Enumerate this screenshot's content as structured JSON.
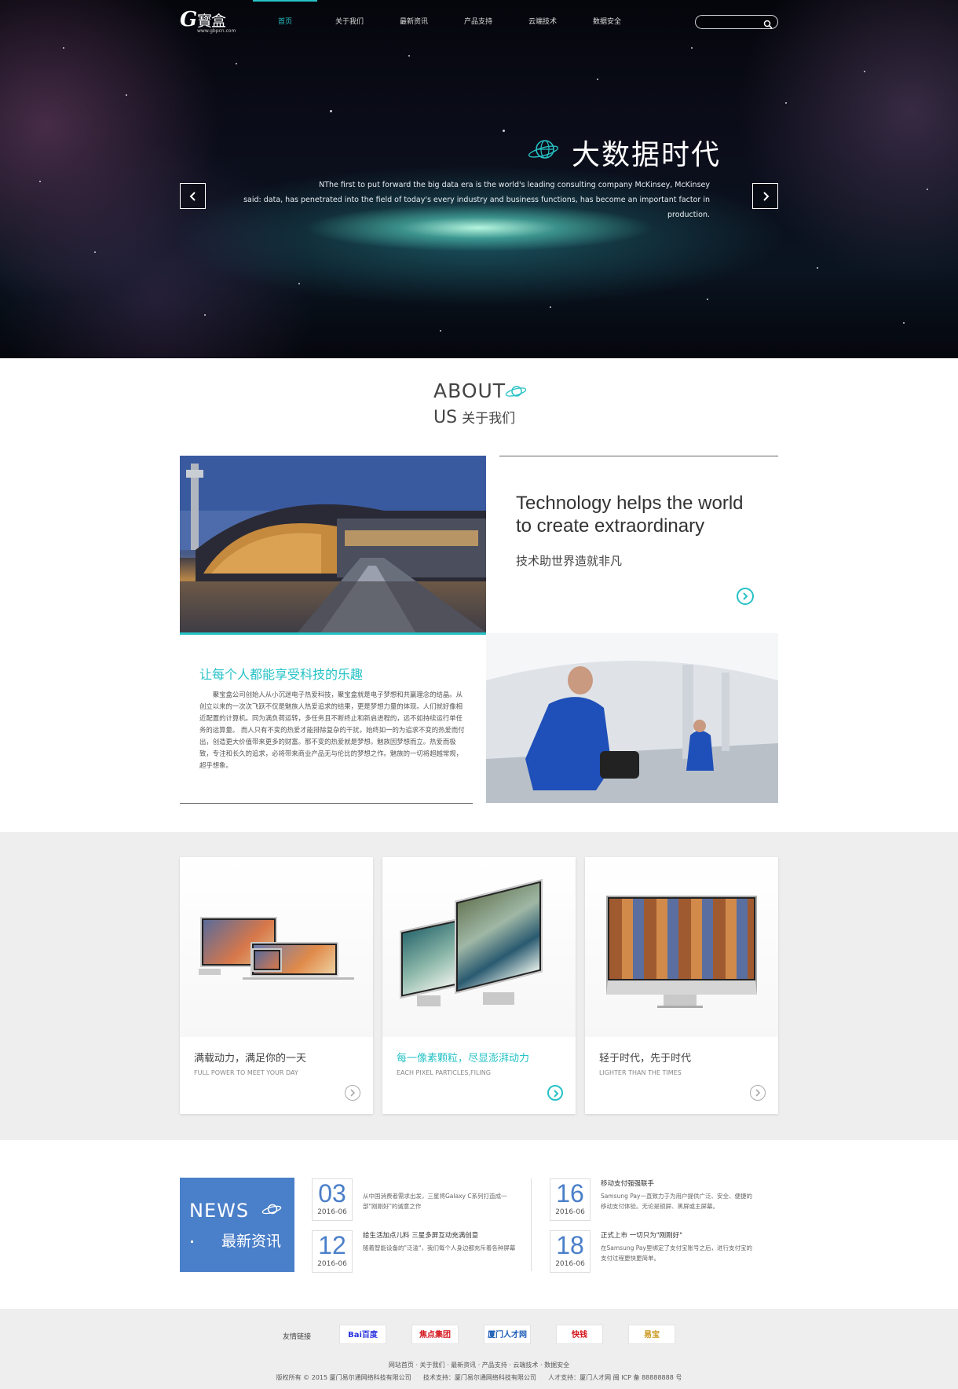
{
  "header": {
    "logo_text": "G寳盒",
    "logo_url": "www.gbpcn.com",
    "nav": [
      {
        "label": "首页",
        "active": true
      },
      {
        "label": "关于我们",
        "active": false
      },
      {
        "label": "最新资讯",
        "active": false
      },
      {
        "label": "产品支持",
        "active": false
      },
      {
        "label": "云端技术",
        "active": false
      },
      {
        "label": "数据安全",
        "active": false
      }
    ],
    "search": {
      "placeholder": "",
      "icon": "search-icon"
    }
  },
  "hero": {
    "title": "大数据时代",
    "text_line1": "NThe first to put forward the big data era is the world's leading consulting company McKinsey, McKinsey",
    "text_line2": "said: data, has penetrated into the field of today's every industry and business functions, has become an important factor in production.",
    "prev_icon": "chevron-left-icon",
    "next_icon": "chevron-right-icon"
  },
  "about": {
    "heading_en1": "ABOUT",
    "heading_en2": "US",
    "heading_cn": "关于我们",
    "tagline_en": "Technology helps the world to create extraordinary",
    "tagline_cn": "技术助世界造就非凡",
    "sub_title": "让每个人都能享受科技的乐趣",
    "paragraph": "聚宝盒公司创始人从小沉迷电子热爱科技，聚宝盒就是电子梦想和共赢理念的结晶。从创立以来的一次次飞跃不仅是魅族人热爱追求的结果，更是梦想力量的体现。人们就好像相近配置的计算机。同为满负荷运转，多任务且不断终止和新启进程的，远不如持续运行单任务的运算量。 而人只有不变的热爱才能排除复杂的干扰，始终如一的为追求不变的热爱而付出，创造更大价值带来更多的财富。那不变的热爱就是梦想。魅族因梦想而立。热爱而极致，专注和长久的追求，必将带来商业产品无与伦比的梦想之作。魅族的一切将超越常规，超乎想象。"
  },
  "products": [
    {
      "title": "满载动力，满足你的一天",
      "subtitle": "FULL POWER TO MEET YOUR DAY",
      "highlight": false
    },
    {
      "title": "每一像素颗粒，尽显澎湃动力",
      "subtitle": "EACH PIXEL PARTICLES,FILING",
      "highlight": true
    },
    {
      "title": "轻于时代，先于时代",
      "subtitle": "LIGHTER THAN THE TIMES",
      "highlight": false
    }
  ],
  "news": {
    "heading_en": "NEWS",
    "heading_cn": "最新资讯",
    "items": [
      {
        "day": "03",
        "ym": "2016-06",
        "title": "",
        "desc": "从中国消费者需求出发，三星将Galaxy C系列打造成一部\"刚刚好\"的诚意之作"
      },
      {
        "day": "12",
        "ym": "2016-06",
        "title": "给生活加点儿料 三星多屏互动充满创意",
        "desc": "随着智能设备的\"泛滥\"，我们每个人身边都充斥着各种屏幕"
      },
      {
        "day": "16",
        "ym": "2016-06",
        "title": "移动支付强强联手",
        "desc": "Samsung Pay一直致力于为用户提供广泛、安全、便捷的移动支付体验。无论是锁屏、黑屏或主屏幕。"
      },
      {
        "day": "18",
        "ym": "2016-06",
        "title": "正式上市 一切只为\"刚刚好\"",
        "desc": "在Samsung Pay里绑定了支付宝账号之后，进行支付宝的支付过程更快更简单。"
      }
    ]
  },
  "footer": {
    "links_label": "友情链接",
    "partners": [
      {
        "name": "Bai百度",
        "color": "#2932e1"
      },
      {
        "name": "焦点集团",
        "color": "#d4141c"
      },
      {
        "name": "厦门人才网",
        "color": "#1a5bb5"
      },
      {
        "name": "快钱",
        "color": "#d4141c"
      },
      {
        "name": "易宝",
        "color": "#c8951a"
      }
    ],
    "nav_line": "网站首页 · 关于我们 · 最新资讯 · 产品支持 · 云端技术 · 数据安全",
    "copyright": "版权所有 © 2015 厦门易尔通网络科技有限公司      技术支持：厦门易尔通网络科技有限公司      人才支持：厦门人才网 闽 ICP 备 88888888 号"
  }
}
